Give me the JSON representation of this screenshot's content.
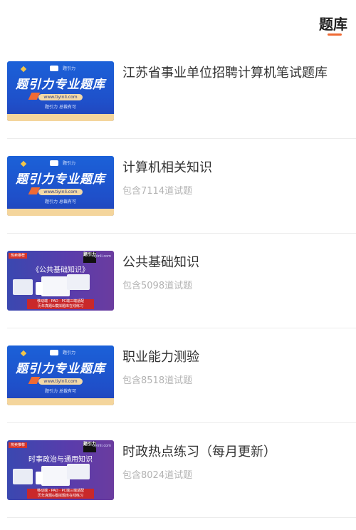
{
  "header": {
    "tab_label": "题库"
  },
  "items": [
    {
      "title": "江苏省事业单位招聘计算机笔试题库",
      "meta": "",
      "thumb": {
        "kind": "blue",
        "headline": "题引力专业题库",
        "url": "www.tiyinli.com",
        "tagline": "题引力 总裁有可",
        "logo_text": "题引力"
      }
    },
    {
      "title": "计算机相关知识",
      "meta": "包含7114道试题",
      "thumb": {
        "kind": "blue",
        "headline": "题引力专业题库",
        "url": "www.tiyinli.com",
        "tagline": "题引力 总裁有可",
        "logo_text": "题引力"
      }
    },
    {
      "title": "公共基础知识",
      "meta": "包含5098道试题",
      "thumb": {
        "kind": "purple",
        "flag": "热卖推荐",
        "brand": "题引力",
        "site": "tiyinli.com",
        "course": "《公共基础知识》",
        "strip1": "移动端 · PAD · PC端三端适配",
        "strip2": "历年真题&模拟题库在线练习"
      }
    },
    {
      "title": "职业能力测验",
      "meta": "包含8518道试题",
      "thumb": {
        "kind": "blue",
        "headline": "题引力专业题库",
        "url": "www.tiyinli.com",
        "tagline": "题引力 总裁有可",
        "logo_text": "题引力"
      }
    },
    {
      "title": "时政热点练习（每月更新）",
      "meta": "包含8024道试题",
      "thumb": {
        "kind": "purple",
        "flag": "热卖推荐",
        "brand": "题引力",
        "site": "tiyinli.com",
        "course": "时事政治与通用知识",
        "strip1": "移动端 · PAD · PC端三端适配",
        "strip2": "历年真题&模拟题库在线练习"
      }
    }
  ]
}
